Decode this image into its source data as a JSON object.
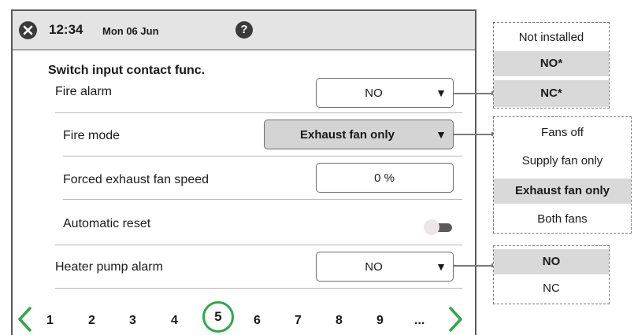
{
  "header": {
    "time": "12:34",
    "date": "Mon 06 Jun",
    "help_label": "?"
  },
  "section": {
    "title": "Switch input contact func."
  },
  "rows": {
    "fire_alarm": {
      "label": "Fire alarm",
      "value": "NO",
      "arrow": "▼"
    },
    "fire_mode": {
      "label": "Fire mode",
      "value": "Exhaust fan only",
      "arrow": "▼"
    },
    "forced_exhaust": {
      "label": "Forced exhaust fan speed",
      "value": "0 %"
    },
    "automatic_reset": {
      "label": "Automatic reset",
      "enabled": false
    },
    "heater_pump_alarm": {
      "label": "Heater pump alarm",
      "value": "NO",
      "arrow": "▼"
    }
  },
  "pager": {
    "pages": [
      "1",
      "2",
      "3",
      "4",
      "5",
      "6",
      "7",
      "8",
      "9",
      "..."
    ],
    "current": "5"
  },
  "popups": {
    "fire_alarm_options": [
      "Not installed",
      "NO*",
      "NC*"
    ],
    "fire_alarm_selected": [
      "NO*",
      "NC*"
    ],
    "fire_mode_options": [
      "Fans off",
      "Supply fan only",
      "Exhaust fan only",
      "Both fans"
    ],
    "fire_mode_selected": "Exhaust fan only",
    "heater_pump_options": [
      "NO",
      "NC"
    ],
    "heater_pump_selected": "NO"
  },
  "colors": {
    "header_bg": "#e4e4e4",
    "accent_green": "#2ea84c",
    "selected_option_bg": "#d9d9d9",
    "grey_select_bg": "#d4d4d4"
  }
}
